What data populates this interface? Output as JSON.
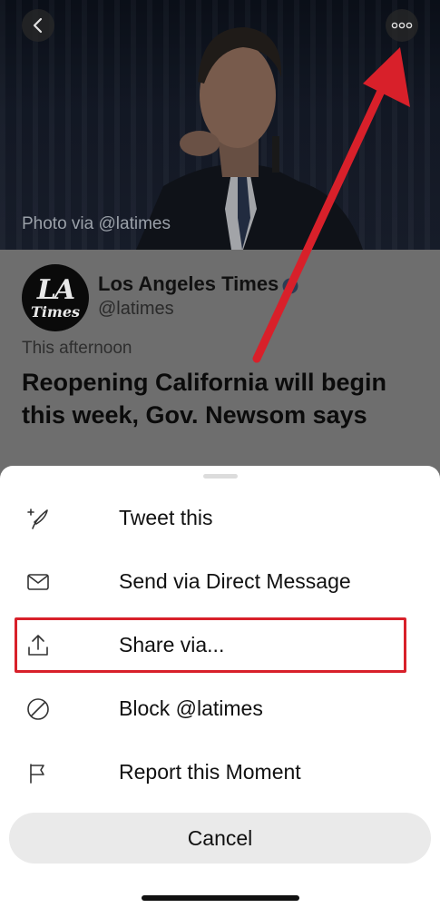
{
  "hero": {
    "photo_credit": "Photo via @latimes",
    "back_icon": "chevron-left-icon",
    "more_icon": "more-horizontal-icon"
  },
  "moment": {
    "publisher_name": "Los Angeles Times",
    "publisher_handle": "@latimes",
    "logo_line1": "LA",
    "logo_line2": "Times",
    "timestamp": "This afternoon",
    "headline": "Reopening California will begin this week, Gov. Newsom says"
  },
  "sheet": {
    "items": [
      {
        "label": "Tweet this",
        "icon": "compose-tweet-icon"
      },
      {
        "label": "Send via Direct Message",
        "icon": "envelope-icon"
      },
      {
        "label": "Share via...",
        "icon": "share-icon"
      },
      {
        "label": "Block @latimes",
        "icon": "block-icon"
      },
      {
        "label": "Report this Moment",
        "icon": "flag-icon"
      }
    ],
    "cancel_label": "Cancel"
  },
  "annotation_color": "#d8202a"
}
